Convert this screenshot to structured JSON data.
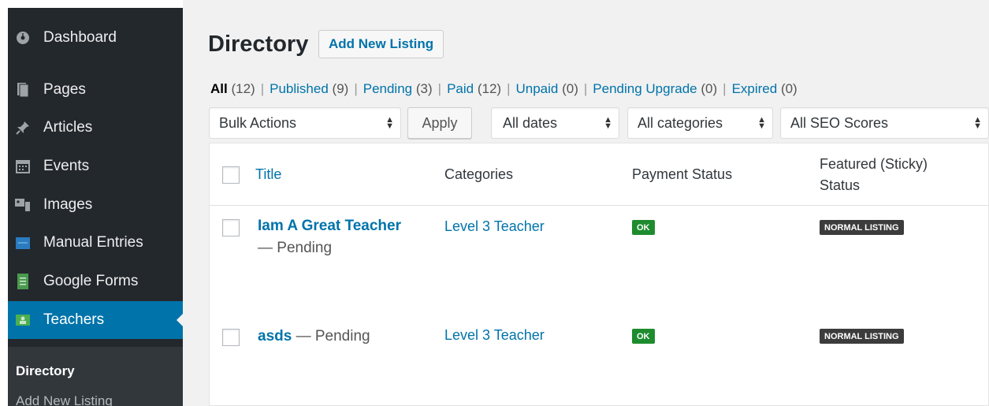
{
  "sidebar": {
    "items": [
      {
        "label": "Dashboard",
        "icon": "dashboard-icon"
      },
      {
        "label": "Pages",
        "icon": "pages-icon"
      },
      {
        "label": "Articles",
        "icon": "pin-icon"
      },
      {
        "label": "Events",
        "icon": "calendar-icon"
      },
      {
        "label": "Images",
        "icon": "images-icon"
      },
      {
        "label": "Manual Entries",
        "icon": "manual-entries-icon"
      },
      {
        "label": "Google Forms",
        "icon": "google-forms-icon"
      },
      {
        "label": "Teachers",
        "icon": "teachers-icon"
      }
    ],
    "active": "Teachers",
    "submenu": [
      {
        "label": "Directory"
      },
      {
        "label": "Add New Listing"
      }
    ]
  },
  "header": {
    "title": "Directory",
    "add_new_label": "Add New Listing"
  },
  "filters": {
    "all": {
      "label": "All",
      "count": "(12)"
    },
    "published": {
      "label": "Published",
      "count": "(9)"
    },
    "pending": {
      "label": "Pending",
      "count": "(3)"
    },
    "paid": {
      "label": "Paid",
      "count": "(12)"
    },
    "unpaid": {
      "label": "Unpaid",
      "count": "(0)"
    },
    "pending_upgrade": {
      "label": "Pending Upgrade",
      "count": "(0)"
    },
    "expired": {
      "label": "Expired",
      "count": "(0)"
    }
  },
  "toolbar": {
    "bulk_actions": "Bulk Actions",
    "apply_label": "Apply",
    "dates": "All dates",
    "categories": "All categories",
    "seo": "All SEO Scores"
  },
  "table": {
    "columns": {
      "title": "Title",
      "categories": "Categories",
      "payment_status": "Payment Status",
      "featured_line1": "Featured (Sticky)",
      "featured_line2": "Status"
    },
    "rows": [
      {
        "title": "Iam A Great Teacher",
        "state": "— Pending",
        "category": "Level 3 Teacher",
        "payment": "OK",
        "featured": "NORMAL LISTING"
      },
      {
        "title": "asds",
        "state": "— Pending",
        "category": "Level 3 Teacher",
        "payment": "OK",
        "featured": "NORMAL LISTING"
      }
    ]
  }
}
